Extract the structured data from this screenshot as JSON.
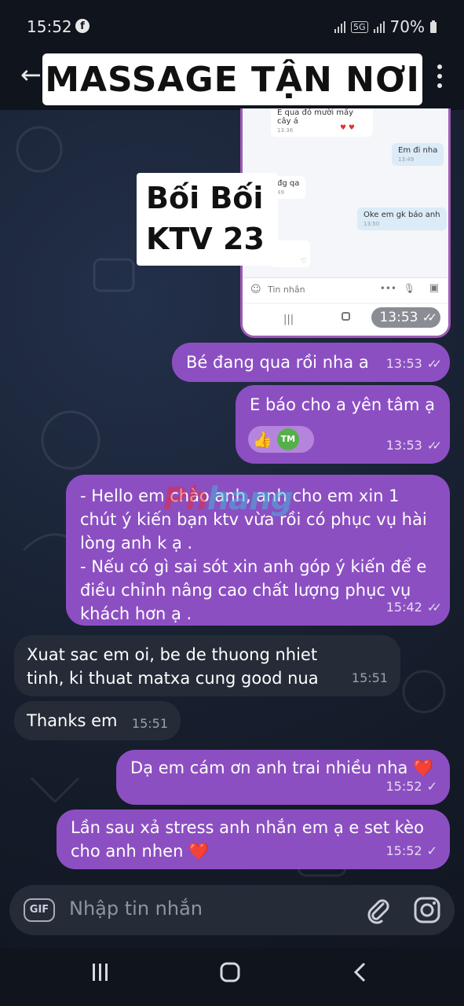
{
  "status_bar": {
    "time": "15:52",
    "battery": "70%",
    "network": "5G"
  },
  "header": {
    "title": "MASSAGE TẬN NƠI"
  },
  "embedded_screenshot": {
    "messages": [
      {
        "text": "E qua đó mười mấy cây á",
        "time": "13:36"
      },
      {
        "text": "Em đi nha",
        "time": "13:49"
      },
      {
        "text": "đg qa",
        "time": "49"
      },
      {
        "text": "Oke em gk báo anh",
        "time": "13:50"
      }
    ],
    "input_placeholder": "Tin nhắn",
    "timestamp": "13:53"
  },
  "ktv_label": {
    "line1": "Bối Bối",
    "line2": "KTV 23"
  },
  "watermark": {
    "part1": "Ph",
    "part2": "hang"
  },
  "messages": [
    {
      "text": "Bé đang qua rồi nha a",
      "time": "13:53"
    },
    {
      "text": "E báo cho a yên tâm ạ",
      "time": "13:53",
      "reaction_badge": "TM"
    },
    {
      "text": "- Hello em chào anh, anh cho em xin 1 chút ý kiến bạn ktv vừa rồi có phục vụ hài lòng anh k ạ .\n- Nếu có gì sai sót xin anh góp ý kiến để e điều chỉnh nâng cao chất lượng phục vụ khách hơn ạ .",
      "time": "15:42"
    },
    {
      "text": "Xuat sac em oi, be de thuong nhiet tinh, ki thuat matxa cung good nua",
      "time": "15:51"
    },
    {
      "text": "Thanks em",
      "time": "15:51"
    },
    {
      "text": "Dạ em cám ơn anh trai nhiều nha ❤️",
      "time": "15:52"
    },
    {
      "text": "Lần sau xả stress anh nhắn em ạ e set kèo cho anh nhen ❤️",
      "time": "15:52"
    }
  ],
  "input": {
    "placeholder": "Nhập tin nhắn",
    "gif_label": "GIF"
  },
  "icons": [
    "back-arrow-icon",
    "more-icon",
    "attach-icon",
    "instagram-icon",
    "recents-icon",
    "home-icon",
    "back-icon"
  ],
  "colors": {
    "outgoing": "#8c4fc2",
    "incoming": "#252c38",
    "background": "#1a2130"
  }
}
